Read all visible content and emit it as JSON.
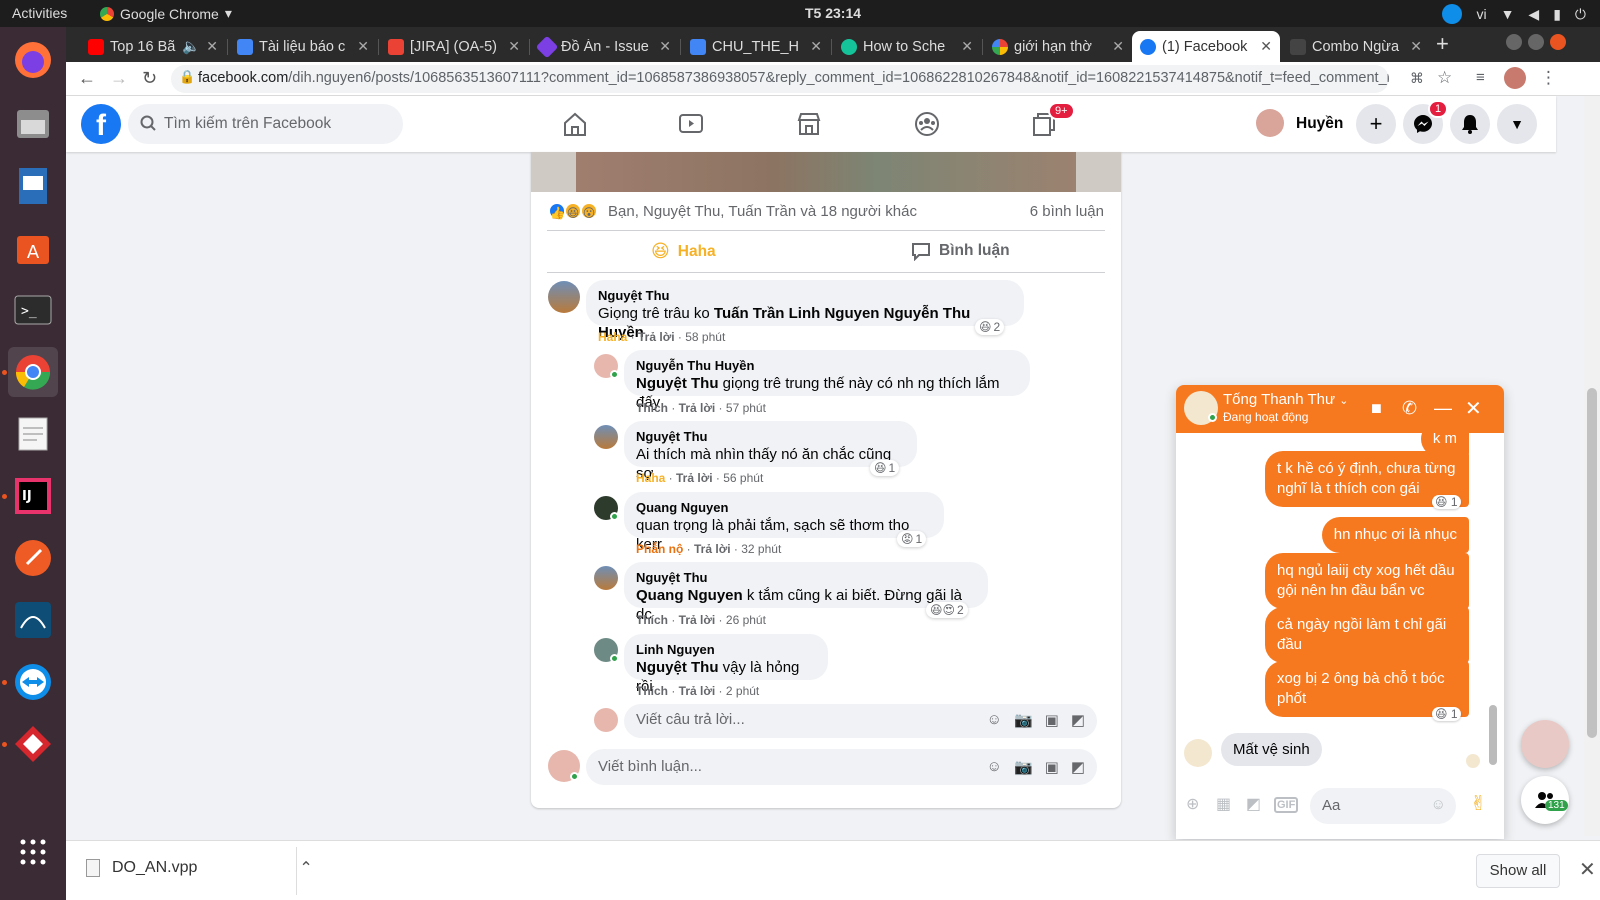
{
  "os": {
    "activities": "Activities",
    "app_name": "Google Chrome",
    "clock": "T5 23:14",
    "lang": "vi"
  },
  "tabs": [
    {
      "title": "Top 16 Bã",
      "color": "#ff0000"
    },
    {
      "title": "Tài liệu báo c",
      "color": "#4285f4"
    },
    {
      "title": "[JIRA] (OA-5)",
      "color": "#ea4335"
    },
    {
      "title": "Đồ Án - Issue",
      "color": "#7b3fe4"
    },
    {
      "title": "CHU_THE_H",
      "color": "#4285f4"
    },
    {
      "title": "How to Sche",
      "color": "#15c39a"
    },
    {
      "title": "giới hạn thờ",
      "color": "#4285f4"
    },
    {
      "title": "(1) Facebook",
      "color": "#1877f2"
    },
    {
      "title": "Combo Ngừa",
      "color": "#444444"
    }
  ],
  "address": {
    "host": "facebook.com",
    "path": "/dih.nguyen6/posts/1068563513607111?comment_id=1068587386938057&reply_comment_id=1068622810267848&notif_id=1608221537414875&notif_t=feed_comment_r..."
  },
  "fb": {
    "search_placeholder": "Tìm kiếm trên Facebook",
    "profile_name": "Huyền",
    "notif_badge": "9+",
    "messenger_badge": "1"
  },
  "post": {
    "reactions_text": "Bạn, Nguyệt Thu, Tuấn Trần và 18 người khác",
    "comment_count": "6 bình luận",
    "haha_label": "Haha",
    "comment_label": "Bình luận",
    "comments": [
      {
        "author": "Nguyệt Thu",
        "tag": "",
        "text": "Giọng trê trâu ko ",
        "tagged_after": "Tuấn Trần Linh Nguyen Nguyễn Thu Huyền",
        "reaction": "Haha",
        "reply": "Trả lời",
        "time": "58 phút",
        "react_count": "2"
      },
      {
        "author": "Nguyễn Thu Huyền",
        "tag": "Nguyệt Thu",
        "text": " giọng trê trung thế này có nh ng thích lắm đấy",
        "reaction": "Thích",
        "reply": "Trả lời",
        "time": "57 phút"
      },
      {
        "author": "Nguyệt Thu",
        "tag": "",
        "text": "Ai thích mà nhìn thấy nó ăn chắc cũng sợ",
        "reaction": "Haha",
        "reply": "Trả lời",
        "time": "56 phút",
        "react_count": "1"
      },
      {
        "author": "Quang Nguyen",
        "tag": "",
        "text": "quan trọng là phải tắm, sạch sẽ thơm tho kerr",
        "reaction": "Phẫn nộ",
        "reply": "Trả lời",
        "time": "32 phút",
        "react_count": "1"
      },
      {
        "author": "Nguyệt Thu",
        "tag": "Quang Nguyen",
        "text": " k tắm cũng k ai biết. Đừng gãi là dc",
        "reaction": "Thích",
        "reply": "Trả lời",
        "time": "26 phút",
        "react_count": "2"
      },
      {
        "author": "Linh Nguyen",
        "tag": "Nguyệt Thu",
        "text": " vậy là hỏng rồi",
        "reaction": "Thích",
        "reply": "Trả lời",
        "time": "2 phút"
      }
    ],
    "reply_placeholder": "Viết câu trả lời...",
    "comment_placeholder": "Viết bình luận..."
  },
  "chat": {
    "name": "Tống Thanh Thư",
    "status": "Đang hoạt động",
    "messages_out": [
      {
        "text": "k m"
      },
      {
        "text": "t k hề có ý định, chưa từng nghĩ là t thích con gái",
        "react_count": "1"
      },
      {
        "text": "hn nhục ơi là nhục"
      },
      {
        "text": "hq ngủ laiij cty xog hết dầu gội nên hn đầu bẩn vc"
      },
      {
        "text": "cả ngày ngồi làm t chỉ gãi đầu"
      },
      {
        "text": "xog bị 2 ông bà chỗ t bóc phốt",
        "react_count": "1"
      }
    ],
    "message_in": "Mất vệ sinh",
    "input_placeholder": "Aa",
    "gif_label": "GIF",
    "contacts_count": "131"
  },
  "download": {
    "file": "DO_AN.vpp",
    "show_all": "Show all"
  }
}
